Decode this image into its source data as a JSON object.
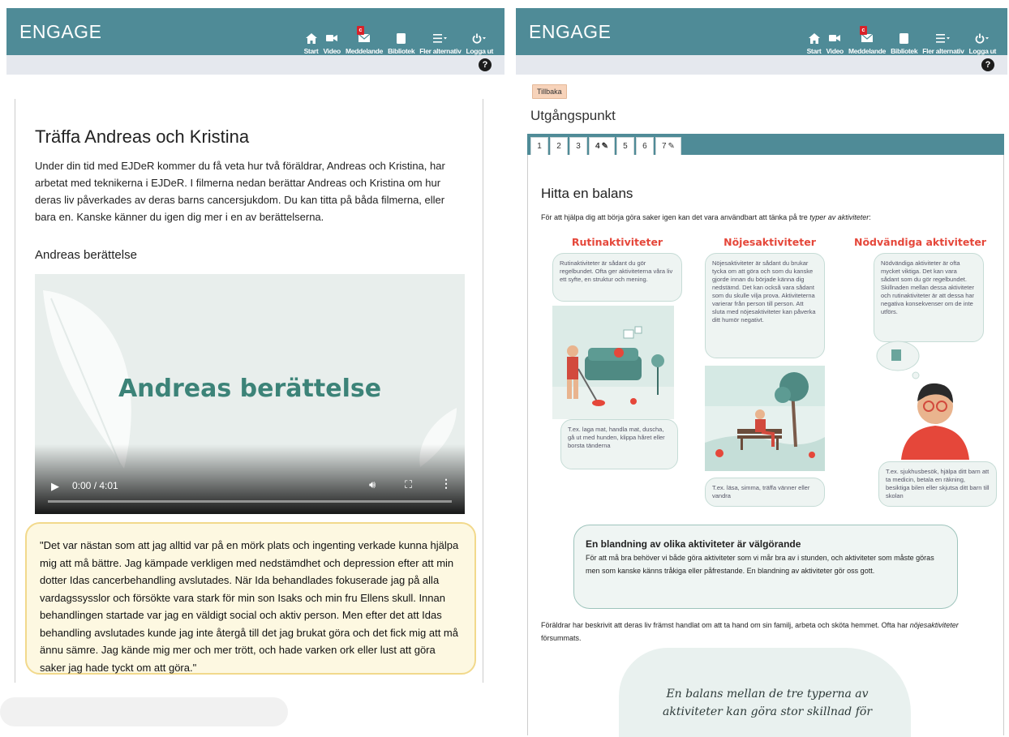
{
  "app": {
    "brand": "ENGAGE",
    "nav": [
      {
        "id": "start",
        "label": "Start",
        "icon": "home-icon"
      },
      {
        "id": "video",
        "label": "Video",
        "icon": "video-camera-icon"
      },
      {
        "id": "messages",
        "label": "Meddelande",
        "icon": "envelope-icon",
        "badge": "c"
      },
      {
        "id": "library",
        "label": "Bibliotek",
        "icon": "book-icon"
      },
      {
        "id": "more",
        "label": "Fler alternativ",
        "icon": "menu-icon"
      },
      {
        "id": "logout",
        "label": "Logga ut",
        "icon": "power-icon"
      }
    ],
    "help": "?"
  },
  "left": {
    "title": "Träffa Andreas och Kristina",
    "intro": "Under din tid med EJDeR kommer du få veta hur två föräldrar, Andreas och Kristina, har arbetat med teknikerna i EJDeR. I filmerna nedan berättar Andreas och Kristina om hur deras liv påverkades av deras barns cancersjukdom. Du kan titta på båda filmerna, eller bara en. Kanske känner du igen dig mer i en av berättelserna.",
    "subheading": "Andreas berättelse",
    "video": {
      "title": "Andreas berättelse",
      "time": "0:00 / 4:01",
      "progress": 0
    },
    "quote": "\"Det var nästan som att jag alltid var på en mörk plats och ingenting verkade kunna hjälpa mig att må bättre. Jag kämpade verkligen med nedstämdhet och depression efter att min dotter Idas cancerbehandling avslutades. När Ida behandlades fokuserade jag på alla vardagssysslor och försökte vara stark för min son Isaks och min fru Ellens skull. Innan behandlingen startade var jag en väldigt social och aktiv person. Men efter det att Idas behandling avslutades kunde jag inte återgå till det jag brukat göra och det fick mig att må ännu sämre. Jag kände mig mer och mer trött, och hade varken ork eller lust att göra saker jag hade tyckt om att göra.\""
  },
  "right": {
    "back_label": "Tillbaka",
    "heading": "Utgångspunkt",
    "tabs": [
      {
        "label": "1",
        "edited": false,
        "active": false
      },
      {
        "label": "2",
        "edited": false,
        "active": false
      },
      {
        "label": "3",
        "edited": false,
        "active": false
      },
      {
        "label": "4",
        "edited": true,
        "active": true
      },
      {
        "label": "5",
        "edited": false,
        "active": false
      },
      {
        "label": "6",
        "edited": false,
        "active": false
      },
      {
        "label": "7",
        "edited": true,
        "active": false
      }
    ],
    "title": "Hitta en balans",
    "intro_pre": "För att hjälpa dig att börja göra saker igen kan det vara användbart att tänka på tre ",
    "intro_em": "typer av aktiviteter",
    "intro_post": ":",
    "columns": [
      {
        "title": "Rutinaktiviteter",
        "top": "Rutinaktiviteter är sådant du gör regelbundet. Ofta ger aktiviteterna våra liv ett syfte, en struktur och mening.",
        "bottom": "T.ex. laga mat, handla mat, duscha, gå ut med hunden, klippa håret eller borsta tänderna"
      },
      {
        "title": "Nöjesaktiviteter",
        "top": "Nöjesaktiviteter är sådant du brukar tycka om att göra och som du kanske gjorde innan du började känna dig nedstämd. Det kan också vara sådant som du skulle vilja prova. Aktiviteterna varierar från person till person. Att sluta med nöjesaktiviteter kan påverka ditt humör negativt.",
        "bottom": "T.ex. läsa, simma, träffa vänner eller vandra"
      },
      {
        "title": "Nödvändiga aktiviteter",
        "top": "Nödvändiga aktiviteter är ofta mycket viktiga. Det kan vara sådant som du gör regelbundet. Skillnaden mellan dessa aktiviteter och rutinaktiviteter är att dessa har negativa konsekvenser om de inte utförs.",
        "bottom": "T.ex. sjukhusbesök, hjälpa ditt barn att ta medicin, betala en räkning, besiktiga bilen eller skjutsa ditt barn till skolan"
      }
    ],
    "mix_title": "En blandning av olika aktiviteter är välgörande",
    "mix_body": "För att må bra behöver vi både göra aktiviteter som vi mår bra av i stunden, och aktiviteter som måste göras men som kanske känns tråkiga eller påfrestande. En blandning av aktiviteter gör oss gott.",
    "outro_pre": "Föräldrar har beskrivit att deras liv främst handlat om att ta hand om sin familj, arbeta och sköta hemmet. Ofta har ",
    "outro_em": "nöjesaktiviteter",
    "outro_post": " försummats.",
    "cloud_text": "En balans mellan de tre typerna av aktiviteter kan göra stor skillnad för"
  },
  "colors": {
    "navbar": "#4f8b97",
    "accent_red": "#e5473a",
    "teal_text": "#3c8378",
    "quote_bg": "#fdf8e1",
    "quote_border": "#f2d98c",
    "back_button": "#f7d3ba"
  }
}
